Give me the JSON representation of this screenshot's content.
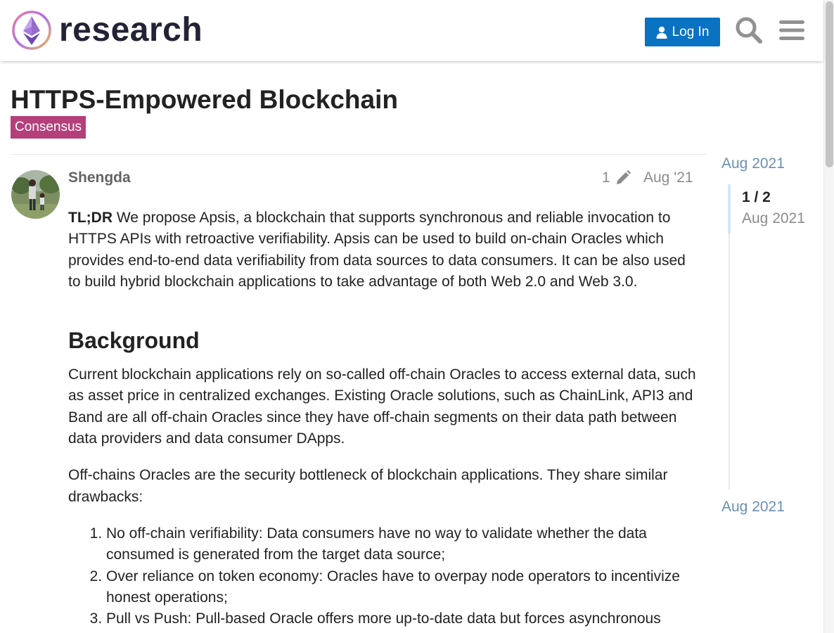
{
  "site": {
    "logo_text": "research"
  },
  "header": {
    "login_label": "Log In"
  },
  "topic": {
    "title": "HTTPS-Empowered Blockchain",
    "category": "Consensus",
    "category_color": "#b3407a"
  },
  "post": {
    "author": "Shengda",
    "edit_count": "1",
    "date": "Aug '21",
    "tldr_label": "TL;DR",
    "tldr_text": " We propose Apsis, a blockchain that supports synchronous and reliable invocation to HTTPS APIs with retroactive verifiability. Apsis can be used to build on-chain Oracles which provides end-to-end data verifiability from data sources to data consumers. It can be also used to build hybrid blockchain applications to take advantage of both Web 2.0 and Web 3.0.",
    "heading_background": "Background",
    "para1": "Current blockchain applications rely on so-called off-chain Oracles to access external data, such as asset price in centralized exchanges. Existing Oracle solutions, such as ChainLink, API3 and Band are all off-chain Oracles since they have off-chain segments on their data path between data providers and data consumer DApps.",
    "para2": "Off-chains Oracles are the security bottleneck of blockchain applications. They share similar drawbacks:",
    "list": [
      "No off-chain verifiability: Data consumers have no way to validate whether the data consumed is generated from the target data source;",
      "Over reliance on token economy: Oracles have to overpay node operators to incentivize honest operations;",
      "Pull vs Push: Pull-based Oracle offers more up-to-date data but forces asynchronous"
    ]
  },
  "timeline": {
    "start_date": "Aug 2021",
    "position": "1 / 2",
    "position_date": "Aug 2021",
    "end_date": "Aug 2021",
    "progress_fraction": 0.5
  },
  "colors": {
    "primary_button": "#0a72c2",
    "timeline_link": "#6b8fb3"
  }
}
